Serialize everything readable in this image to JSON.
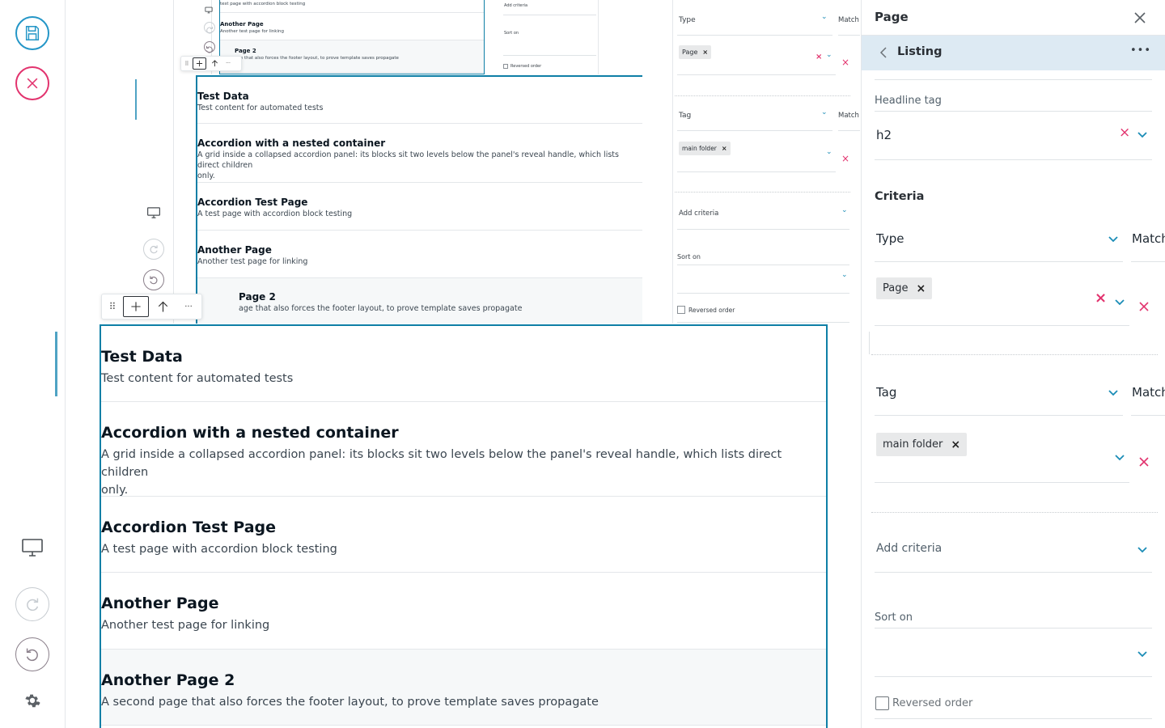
{
  "toolbar": {
    "save_icon": "save-icon",
    "cancel_icon": "close-circle-icon",
    "desktop_icon": "desktop-icon",
    "redo_icon": "redo-icon",
    "undo_icon": "undo-icon",
    "settings_icon": "gear-icon"
  },
  "listing": {
    "items": [
      {
        "title": "Test Data",
        "description": "Test content for automated tests"
      },
      {
        "title": "Accordion with a nested container",
        "description": "A grid inside a collapsed accordion panel: its blocks sit two levels below the panel's reveal handle, which lists direct children only."
      },
      {
        "title": "Accordion Test Page",
        "description": "A test page with accordion block testing"
      },
      {
        "title": "Another Page",
        "description": "Another test page for linking"
      },
      {
        "title": "Another Page 2",
        "description": "A second page that also forces the footer layout, to prove template saves propagate"
      }
    ],
    "mid_item2_desc_lines": [
      "A grid inside a collapsed accordion panel: its blocks sit two levels below the panel's reveal handle, which lists direct children",
      "only."
    ],
    "large_item2_desc_lines": [
      "A grid inside a collapsed accordion panel: its blocks sit two levels below the panel's reveal handle, which lists direct children",
      "only."
    ],
    "mid_toolbar_item_title": "Page 2",
    "mid_toolbar_item_desc": "age that also forces the footer layout, to prove template saves propagate",
    "small_toolbar_item_title": "Page 2",
    "small_toolbar_item_desc": "age that also forces the footer layout, to prove template saves propagate",
    "small_top_desc": "test page with accordion block testing"
  },
  "block_toolbar": {
    "drag_icon": "drag-handle-icon",
    "add_icon": "plus-icon",
    "move_up_icon": "arrow-up-icon",
    "more_icon": "more-icon",
    "more_label": "···"
  },
  "sidebar": {
    "title": "Page",
    "close_icon": "close-icon",
    "breadcrumb": "Listing",
    "back_icon": "chevron-left-icon",
    "more_icon": "more-icon",
    "more_label": "•••",
    "headline_tag_label": "Headline tag",
    "headline_tag_value": "h2",
    "criteria_heading": "Criteria",
    "criteria": [
      {
        "field": "Type",
        "match_label": "Match",
        "chips": [
          "Page"
        ]
      },
      {
        "field": "Tag",
        "match_label": "Match",
        "chips": [
          "main folder"
        ]
      }
    ],
    "add_criteria": "Add criteria",
    "sort_on_label": "Sort on",
    "reversed_order_label": "Reversed order"
  },
  "colors": {
    "accent": "#0e7fa6",
    "save": "#2496c7",
    "cancel": "#e2336e",
    "subheader_bg": "#ddeaf3"
  }
}
